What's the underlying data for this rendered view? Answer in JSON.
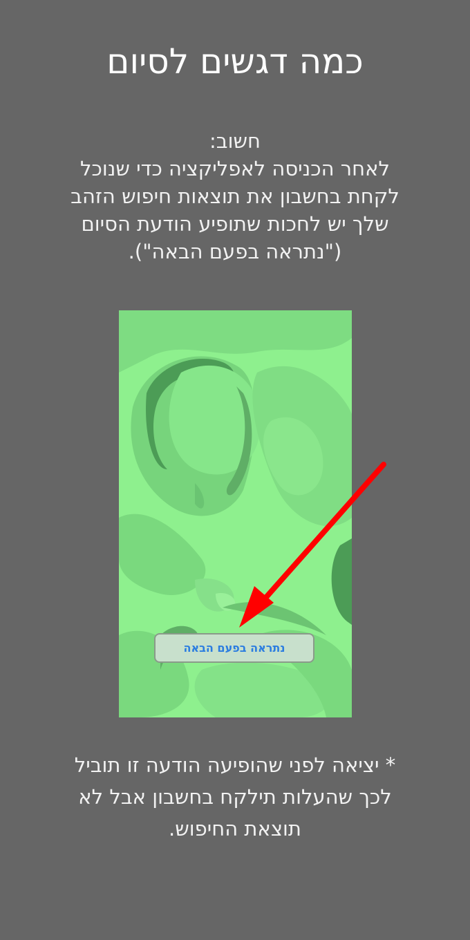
{
  "header": {
    "title": "כמה דגשים לסיום"
  },
  "notice": {
    "heading": "חשוב:",
    "line1": "לאחר הכניסה לאפליקציה כדי שנוכל",
    "line2": "לקחת בחשבון את תוצאות חיפוש הזהב",
    "line3": "שלך יש לחכות שתופיע הודעת הסיום",
    "line4": "(\"נתראה בפעם הבאה\")."
  },
  "screenshot": {
    "button_label": "נתראה בפעם הבאה",
    "background_color": "#8ef08e",
    "arrow_color": "#ff0000"
  },
  "footnote": {
    "line1": "* יציאה לפני שהופיעה הודעה זו תוביל",
    "line2": "לכך שהעלות תילקח בחשבון אבל לא",
    "line3": "תוצאת החיפוש."
  }
}
